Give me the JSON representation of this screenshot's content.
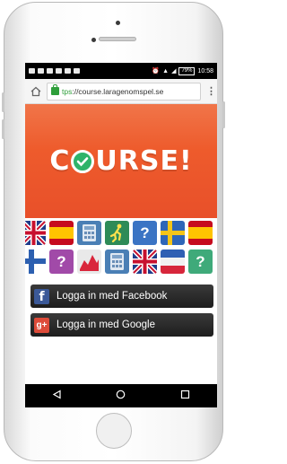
{
  "status_bar": {
    "battery": "79%",
    "time": "10:58"
  },
  "browser": {
    "url_scheme": "tps",
    "url": "://course.laragenomspel.se"
  },
  "hero": {
    "logo_left": "C",
    "logo_right": "URSE!"
  },
  "tiles": {
    "question_mark": "?"
  },
  "login": {
    "facebook_label": "Logga in med Facebook",
    "google_label": "Logga in med Google",
    "facebook_icon_glyph": "f",
    "google_icon_glyph": "g+"
  },
  "colors": {
    "hero": "#ee5b2c",
    "logo_check": "#2fb36a",
    "facebook": "#3b5998",
    "google": "#dd4b39",
    "button_bg": "#262626"
  }
}
